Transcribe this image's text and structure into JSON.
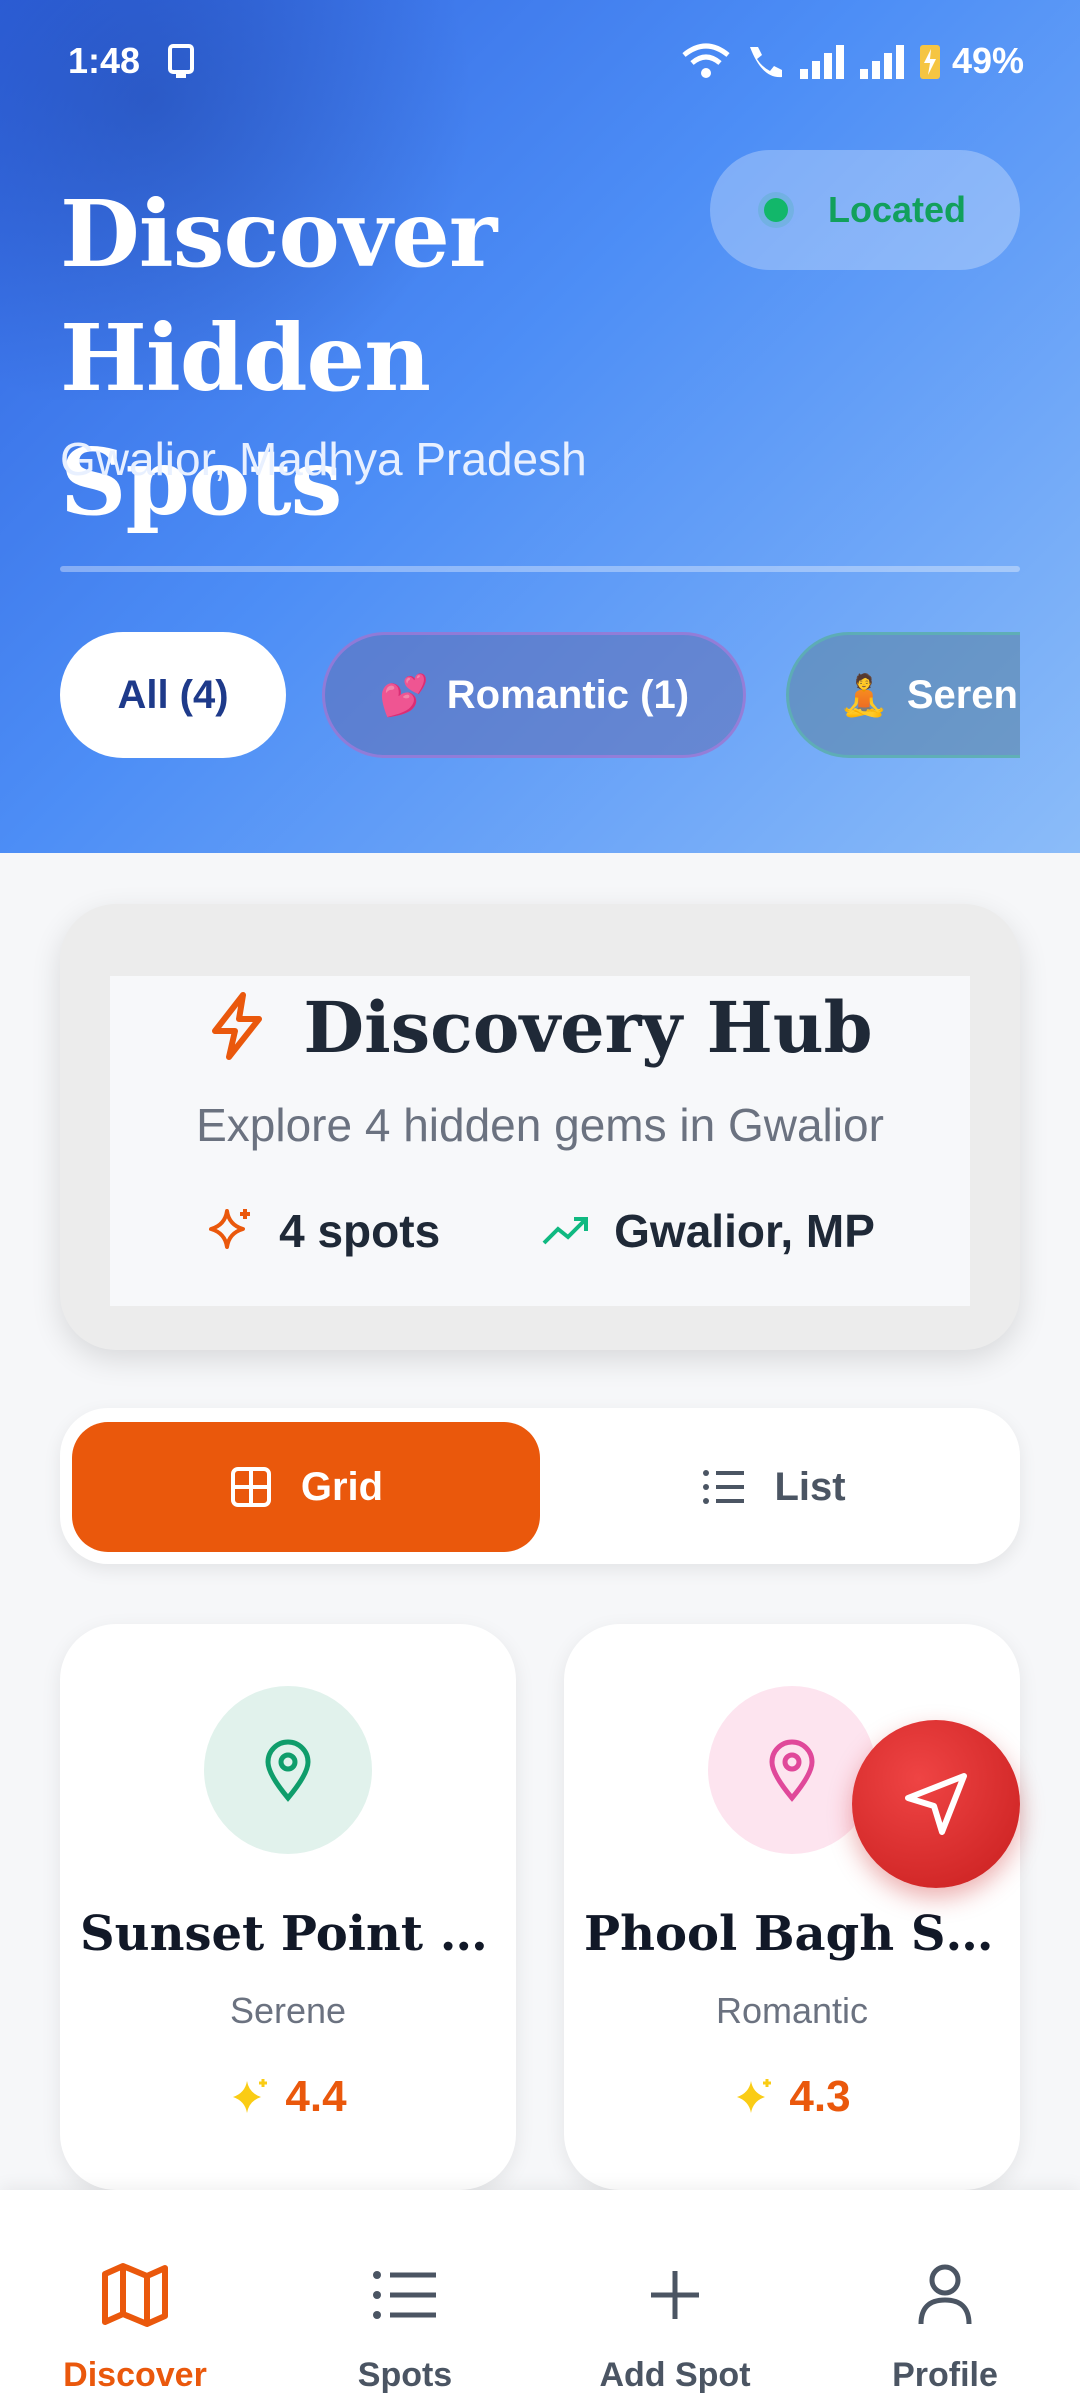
{
  "status_bar": {
    "time": "1:48",
    "battery": "49%"
  },
  "hero": {
    "title_line1": "Discover",
    "title_line2": "Hidden Spots",
    "subtitle": "Gwalior, Madhya Pradesh",
    "location_badge": "Located"
  },
  "filters": [
    {
      "label": "All (4)",
      "emoji": ""
    },
    {
      "label": "Romantic (1)",
      "emoji": "💕"
    },
    {
      "label": "Seren",
      "emoji": "🧘"
    }
  ],
  "hub": {
    "title": "Discovery Hub",
    "description": "Explore 4 hidden gems in Gwalior",
    "spots_stat": "4 spots",
    "location_stat": "Gwalior, MP"
  },
  "view_toggle": {
    "grid_label": "Grid",
    "list_label": "List"
  },
  "spots": [
    {
      "name": "Sunset Point a...",
      "category": "Serene",
      "rating": "4.4"
    },
    {
      "name": "Phool Bagh Se...",
      "category": "Romantic",
      "rating": "4.3"
    }
  ],
  "bottom_nav": [
    {
      "label": "Discover"
    },
    {
      "label": "Spots"
    },
    {
      "label": "Add Spot"
    },
    {
      "label": "Profile"
    }
  ],
  "colors": {
    "accent": "#ea580c",
    "hero_blue": "#4d8ef6",
    "located_green": "#12b76a",
    "fab_red": "#dc2626"
  }
}
